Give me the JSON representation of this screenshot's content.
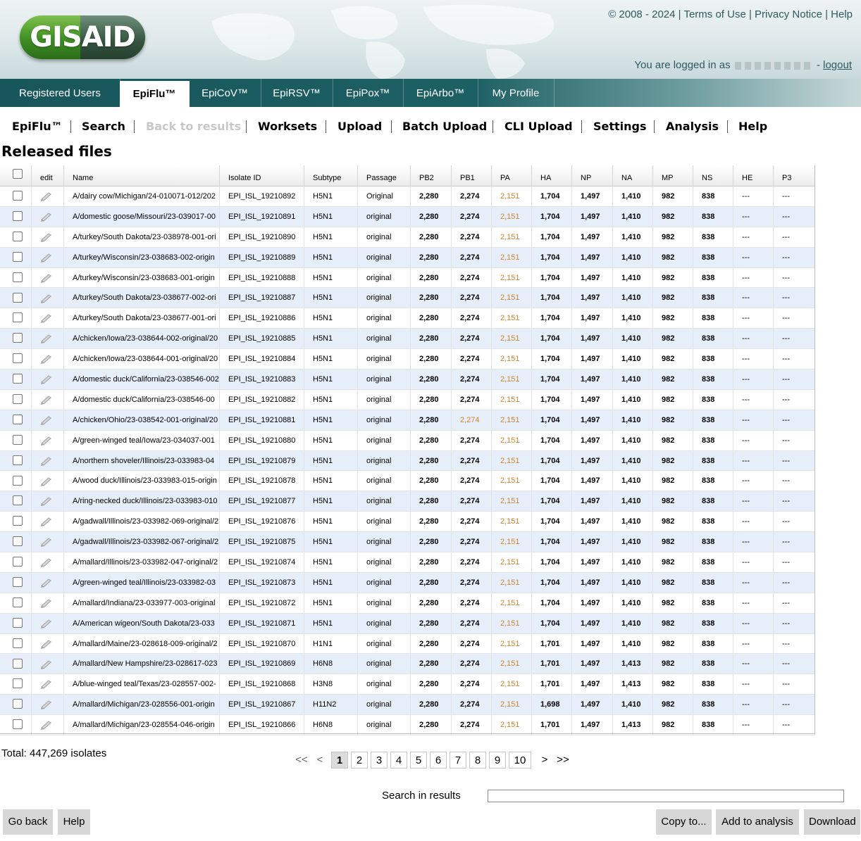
{
  "logo_text": "GISAID",
  "toplinks": {
    "copyright": "© 2008 - 2024",
    "terms": "Terms of Use",
    "privacy": "Privacy Notice",
    "help": "Help"
  },
  "login": {
    "prefix": "You are logged in as",
    "logout": "logout"
  },
  "tabs": [
    "Registered Users",
    "EpiFlu™",
    "EpiCoV™",
    "EpiRSV™",
    "EpiPox™",
    "EpiArbo™",
    "My Profile"
  ],
  "active_tab": "EpiFlu™",
  "submenu": {
    "epiflu": "EpiFlu™",
    "search": "Search",
    "back": "Back to results",
    "worksets": "Worksets",
    "upload": "Upload",
    "batch": "Batch Upload",
    "cli": "CLI Upload",
    "settings": "Settings",
    "analysis": "Analysis",
    "help": "Help"
  },
  "page_title": "Released files",
  "columns": [
    "edit",
    "Name",
    "Isolate ID",
    "Subtype",
    "Passage",
    "PB2",
    "PB1",
    "PA",
    "HA",
    "NP",
    "NA",
    "MP",
    "NS",
    "HE",
    "P3"
  ],
  "rows": [
    [
      "A/dairy cow/Michigan/24-010071-012/202",
      "EPI_ISL_19210892",
      "H5N1",
      "Original",
      "2,280",
      "2,274",
      "2,151",
      "1,704",
      "1,497",
      "1,410",
      "982",
      "838",
      "---",
      "---"
    ],
    [
      "A/domestic goose/Missouri/23-039017-00",
      "EPI_ISL_19210891",
      "H5N1",
      "original",
      "2,280",
      "2,274",
      "2,151",
      "1,704",
      "1,497",
      "1,410",
      "982",
      "838",
      "---",
      "---"
    ],
    [
      "A/turkey/South Dakota/23-038978-001-ori",
      "EPI_ISL_19210890",
      "H5N1",
      "original",
      "2,280",
      "2,274",
      "2,151",
      "1,704",
      "1,497",
      "1,410",
      "982",
      "838",
      "---",
      "---"
    ],
    [
      "A/turkey/Wisconsin/23-038683-002-origin",
      "EPI_ISL_19210889",
      "H5N1",
      "original",
      "2,280",
      "2,274",
      "2,151",
      "1,704",
      "1,497",
      "1,410",
      "982",
      "838",
      "---",
      "---"
    ],
    [
      "A/turkey/Wisconsin/23-038683-001-origin",
      "EPI_ISL_19210888",
      "H5N1",
      "original",
      "2,280",
      "2,274",
      "2,151",
      "1,704",
      "1,497",
      "1,410",
      "982",
      "838",
      "---",
      "---"
    ],
    [
      "A/turkey/South Dakota/23-038677-002-ori",
      "EPI_ISL_19210887",
      "H5N1",
      "original",
      "2,280",
      "2,274",
      "2,151",
      "1,704",
      "1,497",
      "1,410",
      "982",
      "838",
      "---",
      "---"
    ],
    [
      "A/turkey/South Dakota/23-038677-001-ori",
      "EPI_ISL_19210886",
      "H5N1",
      "original",
      "2,280",
      "2,274",
      "2,151",
      "1,704",
      "1,497",
      "1,410",
      "982",
      "838",
      "---",
      "---"
    ],
    [
      "A/chicken/Iowa/23-038644-002-original/20",
      "EPI_ISL_19210885",
      "H5N1",
      "original",
      "2,280",
      "2,274",
      "2,151",
      "1,704",
      "1,497",
      "1,410",
      "982",
      "838",
      "---",
      "---"
    ],
    [
      "A/chicken/Iowa/23-038644-001-original/20",
      "EPI_ISL_19210884",
      "H5N1",
      "original",
      "2,280",
      "2,274",
      "2,151",
      "1,704",
      "1,497",
      "1,410",
      "982",
      "838",
      "---",
      "---"
    ],
    [
      "A/domestic duck/California/23-038546-002",
      "EPI_ISL_19210883",
      "H5N1",
      "original",
      "2,280",
      "2,274",
      "2,151",
      "1,704",
      "1,497",
      "1,410",
      "982",
      "838",
      "---",
      "---"
    ],
    [
      "A/domestic duck/California/23-038546-00",
      "EPI_ISL_19210882",
      "H5N1",
      "original",
      "2,280",
      "2,274",
      "2,151",
      "1,704",
      "1,497",
      "1,410",
      "982",
      "838",
      "---",
      "---"
    ],
    [
      "A/chicken/Ohio/23-038542-001-original/20",
      "EPI_ISL_19210881",
      "H5N1",
      "original",
      "2,280",
      "2,274",
      "2,151",
      "1,704",
      "1,497",
      "1,410",
      "982",
      "838",
      "---",
      "---"
    ],
    [
      "A/green-winged teal/Iowa/23-034037-001",
      "EPI_ISL_19210880",
      "H5N1",
      "original",
      "2,280",
      "2,274",
      "2,151",
      "1,704",
      "1,497",
      "1,410",
      "982",
      "838",
      "---",
      "---"
    ],
    [
      "A/northern shoveler/Illinois/23-033983-04",
      "EPI_ISL_19210879",
      "H5N1",
      "original",
      "2,280",
      "2,274",
      "2,151",
      "1,704",
      "1,497",
      "1,410",
      "982",
      "838",
      "---",
      "---"
    ],
    [
      "A/wood duck/Illinois/23-033983-015-origin",
      "EPI_ISL_19210878",
      "H5N1",
      "original",
      "2,280",
      "2,274",
      "2,151",
      "1,704",
      "1,497",
      "1,410",
      "982",
      "838",
      "---",
      "---"
    ],
    [
      "A/ring-necked duck/Illinois/23-033983-010",
      "EPI_ISL_19210877",
      "H5N1",
      "original",
      "2,280",
      "2,274",
      "2,151",
      "1,704",
      "1,497",
      "1,410",
      "982",
      "838",
      "---",
      "---"
    ],
    [
      "A/gadwall/Illinois/23-033982-069-original/2",
      "EPI_ISL_19210876",
      "H5N1",
      "original",
      "2,280",
      "2,274",
      "2,151",
      "1,704",
      "1,497",
      "1,410",
      "982",
      "838",
      "---",
      "---"
    ],
    [
      "A/gadwall/Illinois/23-033982-067-original/2",
      "EPI_ISL_19210875",
      "H5N1",
      "original",
      "2,280",
      "2,274",
      "2,151",
      "1,704",
      "1,497",
      "1,410",
      "982",
      "838",
      "---",
      "---"
    ],
    [
      "A/mallard/Illinois/23-033982-047-original/2",
      "EPI_ISL_19210874",
      "H5N1",
      "original",
      "2,280",
      "2,274",
      "2,151",
      "1,704",
      "1,497",
      "1,410",
      "982",
      "838",
      "---",
      "---"
    ],
    [
      "A/green-winged teal/Illinois/23-033982-03",
      "EPI_ISL_19210873",
      "H5N1",
      "original",
      "2,280",
      "2,274",
      "2,151",
      "1,704",
      "1,497",
      "1,410",
      "982",
      "838",
      "---",
      "---"
    ],
    [
      "A/mallard/Indiana/23-033977-003-original",
      "EPI_ISL_19210872",
      "H5N1",
      "original",
      "2,280",
      "2,274",
      "2,151",
      "1,704",
      "1,497",
      "1,410",
      "982",
      "838",
      "---",
      "---"
    ],
    [
      "A/American wigeon/South Dakota/23-033",
      "EPI_ISL_19210871",
      "H5N1",
      "original",
      "2,280",
      "2,274",
      "2,151",
      "1,704",
      "1,497",
      "1,410",
      "982",
      "838",
      "---",
      "---"
    ],
    [
      "A/mallard/Maine/23-028618-009-original/2",
      "EPI_ISL_19210870",
      "H1N1",
      "original",
      "2,280",
      "2,274",
      "2,151",
      "1,701",
      "1,497",
      "1,410",
      "982",
      "838",
      "---",
      "---"
    ],
    [
      "A/mallard/New Hampshire/23-028617-023",
      "EPI_ISL_19210869",
      "H6N8",
      "original",
      "2,280",
      "2,274",
      "2,151",
      "1,701",
      "1,497",
      "1,413",
      "982",
      "838",
      "---",
      "---"
    ],
    [
      "A/blue-winged teal/Texas/23-028557-002-",
      "EPI_ISL_19210868",
      "H3N8",
      "original",
      "2,280",
      "2,274",
      "2,151",
      "1,701",
      "1,497",
      "1,413",
      "982",
      "838",
      "---",
      "---"
    ],
    [
      "A/mallard/Michigan/23-028556-001-origin",
      "EPI_ISL_19210867",
      "H11N2",
      "original",
      "2,280",
      "2,274",
      "2,151",
      "1,698",
      "1,497",
      "1,410",
      "982",
      "838",
      "---",
      "---"
    ],
    [
      "A/mallard/Michigan/23-028554-046-origin",
      "EPI_ISL_19210866",
      "H6N8",
      "original",
      "2,280",
      "2,274",
      "2,151",
      "1,701",
      "1,497",
      "1,413",
      "982",
      "838",
      "---",
      "---"
    ]
  ],
  "orange_cells": {
    "pa_all": true,
    "pb1_row": 11
  },
  "highlight_color": "#d2852a",
  "total": "Total: 447,269 isolates",
  "pager": {
    "first": "<<",
    "prev": "<",
    "pages": [
      "1",
      "2",
      "3",
      "4",
      "5",
      "6",
      "7",
      "8",
      "9",
      "10"
    ],
    "current": "1",
    "next": ">",
    "last": ">>"
  },
  "search": {
    "label": "Search in results",
    "value": ""
  },
  "buttons": {
    "go_back": "Go back",
    "help": "Help",
    "copy": "Copy to...",
    "add": "Add to analysis",
    "download": "Download"
  }
}
